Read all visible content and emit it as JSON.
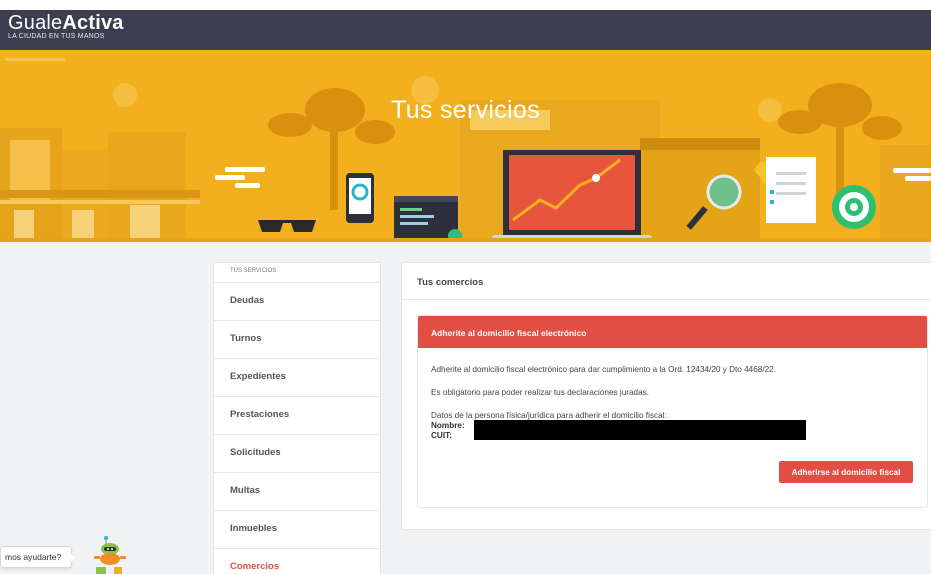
{
  "header": {
    "logo_prefix": "Guale",
    "logo_bold": "Activa",
    "logo_tagline": "LA CIUDAD EN TUS MANOS"
  },
  "hero": {
    "title": "Tus servicios"
  },
  "sidebar": {
    "header": "TUS SERVICIOS",
    "items": [
      {
        "label": "Deudas"
      },
      {
        "label": "Turnos"
      },
      {
        "label": "Expedientes"
      },
      {
        "label": "Prestaciones"
      },
      {
        "label": "Solicitudes"
      },
      {
        "label": "Multas"
      },
      {
        "label": "Inmuebles"
      },
      {
        "label": "Comercios",
        "active": true
      }
    ]
  },
  "main": {
    "panel_title": "Tus comercios",
    "alert": {
      "header": "Adherite al domicilio fiscal electrónico",
      "line1": "Adherite al domicilio fiscal electrónico para dar cumplimiento a la Ord. 12434/20 y Dto 4468/22.",
      "line2": "Es obligatorio para poder realizar tus declaraciones juradas.",
      "line3": "Datos de la persona física/jurídica para adherir el domicilio fiscal:",
      "nombre_label": "Nombre:",
      "cuit_label": "CUIT:",
      "button": "Adherirse al domicilio fiscal"
    }
  },
  "chat": {
    "bubble": "mos ayudarte?"
  },
  "colors": {
    "topbar": "#3b3e4f",
    "hero": "#f2b01e",
    "accent": "#e14e43",
    "background": "#f1f2f4"
  }
}
